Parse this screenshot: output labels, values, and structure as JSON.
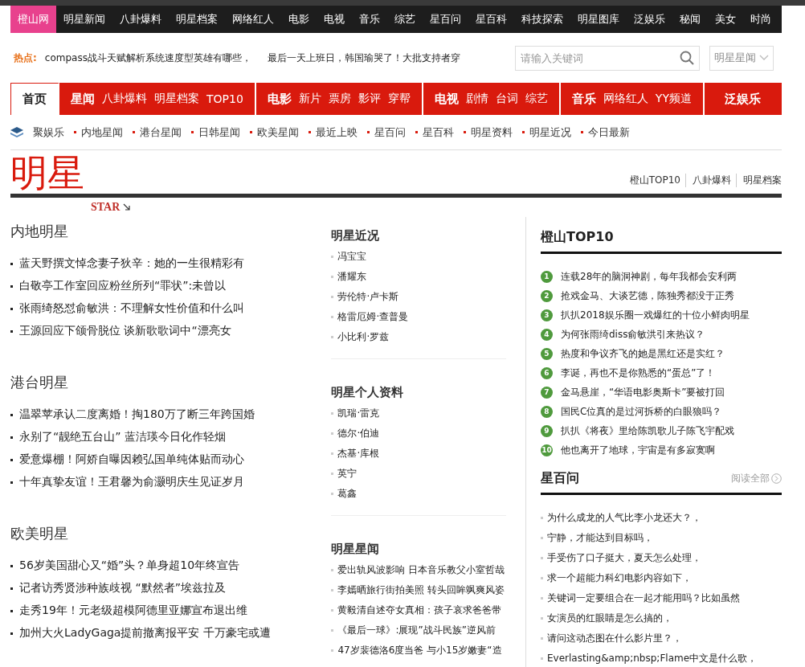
{
  "top_nav": [
    {
      "label": "橙山网",
      "selected": true
    },
    {
      "label": "明星新闻",
      "selected": false
    },
    {
      "label": "八卦爆料",
      "selected": false
    },
    {
      "label": "明星档案",
      "selected": false
    },
    {
      "label": "网络红人",
      "selected": false
    },
    {
      "label": "电影",
      "selected": false
    },
    {
      "label": "电视",
      "selected": false
    },
    {
      "label": "音乐",
      "selected": false
    },
    {
      "label": "综艺",
      "selected": false
    },
    {
      "label": "星百问",
      "selected": false
    },
    {
      "label": "星百科",
      "selected": false
    },
    {
      "label": "科技探索",
      "selected": false
    },
    {
      "label": "明星图库",
      "selected": false
    },
    {
      "label": "泛娱乐",
      "selected": false
    },
    {
      "label": "秘闻",
      "selected": false
    },
    {
      "label": "美女",
      "selected": false
    },
    {
      "label": "时尚",
      "selected": false
    }
  ],
  "hot": {
    "label": "热点:",
    "items": [
      "compass战斗天赋解析系统速度型英雄有哪些，",
      "最后一天上班日，韩国瑜哭了！大批支持者穿"
    ]
  },
  "search": {
    "placeholder": "请输入关键词"
  },
  "category_select": {
    "value": "明星星闻"
  },
  "main_menu": [
    {
      "title": "首页",
      "selected": true
    },
    {
      "title": "星闻",
      "selected": false,
      "links": [
        "八卦爆料",
        "明星档案",
        "TOP10"
      ]
    },
    {
      "title": "电影",
      "selected": false,
      "links": [
        "新片",
        "票房",
        "影评",
        "穿帮"
      ]
    },
    {
      "title": "电视",
      "selected": false,
      "links": [
        "剧情",
        "台词",
        "综艺"
      ]
    },
    {
      "title": "音乐",
      "selected": false,
      "links": [
        "网络红人",
        "YY频道"
      ]
    },
    {
      "title": "泛娱乐",
      "selected": false
    }
  ],
  "sub_nav": {
    "title": "聚娱乐",
    "items": [
      "内地星闻",
      "港台星闻",
      "日韩星闻",
      "欧美星闻",
      "最近上映",
      "星百问",
      "星百科",
      "明星资料",
      "明星近况",
      "今日最新"
    ]
  },
  "header": {
    "title": "明星",
    "subtitle": "STAR",
    "breadcrumb": [
      "橙山TOP10",
      "八卦爆料",
      "明星档案"
    ]
  },
  "left_sections": [
    {
      "title": "内地明星",
      "items": [
        "蓝天野撰文悼念妻子狄辛：她的一生很精彩有",
        "白敬亭工作室回应粉丝所列“罪状”:未曾以",
        "张雨绮怒怼俞敏洪：不理解女性价值和什么叫",
        "王源回应下颌骨脱位 谈新歌歌词中“漂亮女"
      ]
    },
    {
      "title": "港台明星",
      "items": [
        "温翠苹承认二度离婚！掏180万了断三年跨国婚",
        "永别了“靓绝五台山” 蓝洁瑛今日化作轻烟",
        "爱意爆棚！阿娇自曝因赖弘国单纯体贴而动心",
        "十年真挚友谊！王君馨为俞灏明庆生见证岁月"
      ]
    },
    {
      "title": "欧美明星",
      "items": [
        "56岁美国甜心又“婚”头？单身超10年终宣告",
        "记者访秀贤涉种族歧视 “默然者”埃兹拉及",
        "走秀19年！元老级超模阿德里亚娜宣布退出维",
        "加州大火LadyGaga提前撤离报平安 千万豪宅或遭"
      ]
    }
  ],
  "middle_sections": [
    {
      "title": "明星近况",
      "items": [
        "冯宝宝",
        "潘耀东",
        "劳伦特·卢卡斯",
        "格雷厄姆·查普曼",
        "小比利·罗兹"
      ]
    },
    {
      "title": "明星个人资料",
      "items": [
        "凯瑞·雷克",
        "德尔·伯迪",
        "杰基·库根",
        "英宁",
        "葛鑫"
      ]
    },
    {
      "title": "明星星闻",
      "items": [
        "爱出轨风波影响 日本音乐教父小室哲哉",
        "李嫣晒旅行街拍美照 转头回眸飒爽风姿",
        "黄毅清自述夺女真相：孩子哀求爸爸带",
        "《最后一球》:展现”战斗民族”逆风前",
        "47岁裴德洛6度当爸 与小15岁嫩妻“造"
      ]
    }
  ],
  "top10": {
    "title": "橙山TOP10",
    "items": [
      {
        "rank": "1",
        "text": "连载28年的脑洞神剧，每年我都会安利两"
      },
      {
        "rank": "2",
        "text": "抢戏金马、大谈艺德，陈独秀都没于正秀"
      },
      {
        "rank": "3",
        "text": "扒扒2018娱乐圈一戏爆红的十位小鲜肉明星"
      },
      {
        "rank": "4",
        "text": "为何张雨绮diss俞敏洪引来热议？"
      },
      {
        "rank": "5",
        "text": "热度和争议齐飞的她是黑红还是实红？"
      },
      {
        "rank": "6",
        "text": "李诞，再也不是你熟悉的“蛋总”了！"
      },
      {
        "rank": "7",
        "text": "金马悬崖，“华语电影奥斯卡”要被打回"
      },
      {
        "rank": "8",
        "text": "国民C位真的是过河拆桥的白眼狼吗？"
      },
      {
        "rank": "9",
        "text": "扒扒《将夜》里给陈凯歌儿子陈飞宇配戏"
      },
      {
        "rank": "10",
        "text": "他也离开了地球，宇宙是有多寂寞啊"
      }
    ]
  },
  "questions": {
    "title": "星百问",
    "more": "阅读全部",
    "items": [
      "为什么成龙的人气比李小龙还大？，",
      "宁静，才能达到目标吗，",
      "手受伤了口子挺大，夏天怎么处理，",
      "求一个超能力科幻电影内容如下，",
      "关键词一定要组合在一起才能用吗？比如虽然",
      "女演员的红眼睛是怎么搞的，",
      "请问这动态图在什么影片里？，",
      "Everlasting&amp;nbsp;Flame中文是什么歌，"
    ]
  }
}
